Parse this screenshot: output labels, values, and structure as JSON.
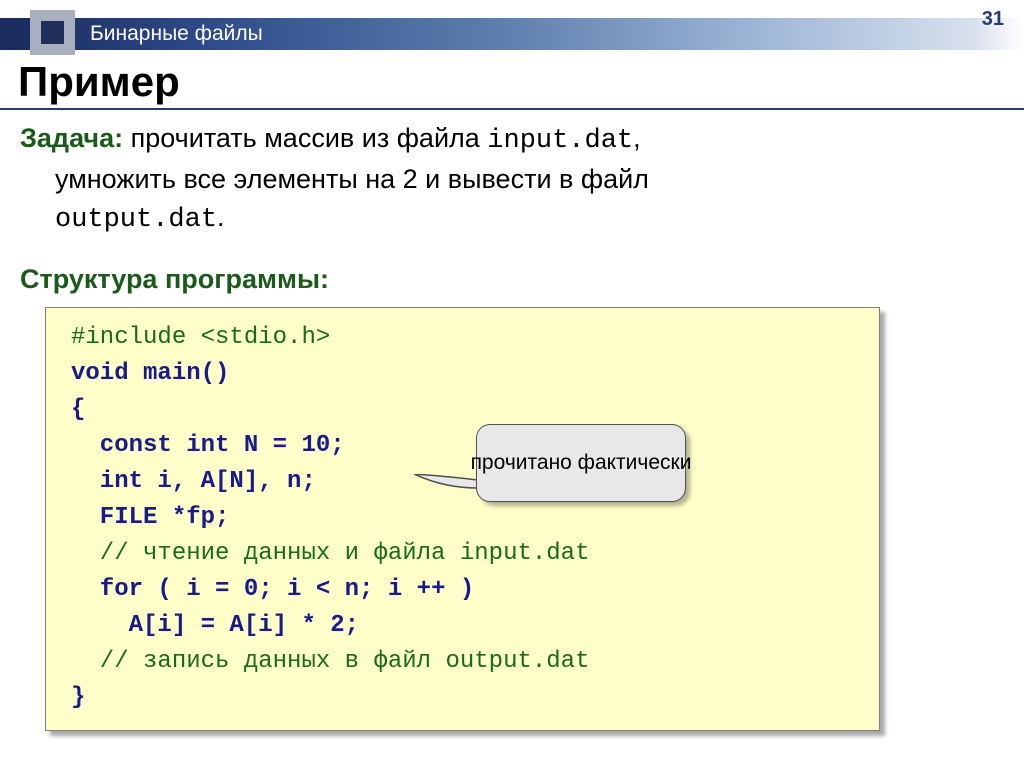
{
  "slide_number": "31",
  "header": "Бинарные файлы",
  "title": "Пример",
  "task": {
    "label": "Задача:",
    "text_before_file1": " прочитать массив из файла ",
    "file1": "input.dat",
    "text_line2a": "умножить все элементы на 2 и вывести в файл",
    "file2": "output.dat",
    "period": "."
  },
  "struct_label": "Структура программы:",
  "code": {
    "l1a": "#include ",
    "l1b": "<stdio.h>",
    "l2": "void main()",
    "l3": "{",
    "l4": "  const int N = 10;",
    "l5": "  int i, A[N], n;",
    "l6": "  FILE *fp;",
    "l7": "  // чтение данных и файла input.dat",
    "l8a": "  for",
    "l8b": " ( i = 0; i < n; i ++ )",
    "l9": "    A[i] = A[i] * 2;",
    "l10": "  // запись данных в файл output.dat",
    "l11": "}"
  },
  "callout": "прочитано фактически"
}
